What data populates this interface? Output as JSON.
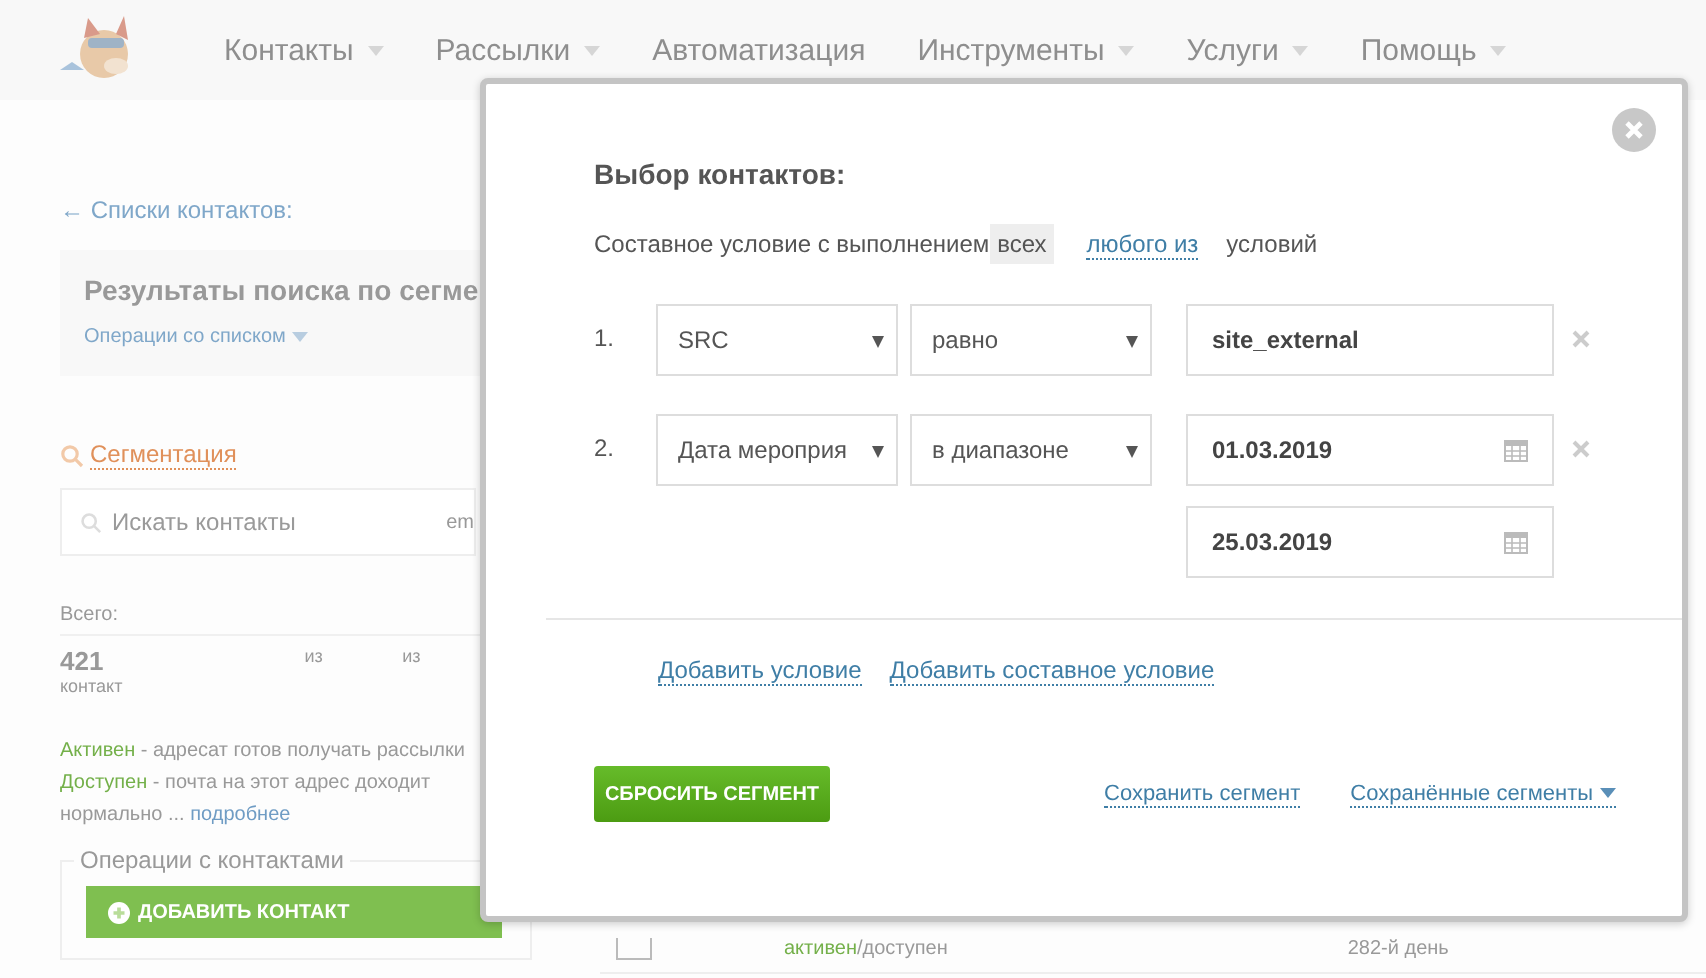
{
  "nav": {
    "items": [
      {
        "label": "Контакты",
        "dropdown": true
      },
      {
        "label": "Рассылки",
        "dropdown": true
      },
      {
        "label": "Автоматизация",
        "dropdown": false
      },
      {
        "label": "Инструменты",
        "dropdown": true
      },
      {
        "label": "Услуги",
        "dropdown": true
      },
      {
        "label": "Помощь",
        "dropdown": true
      }
    ]
  },
  "back_link": "← Списки контактов:",
  "list_panel": {
    "title": "Результаты поиска по сегме",
    "operations": "Операции со списком"
  },
  "segmentation_link": "Сегментация",
  "search": {
    "placeholder": "Искать контакты",
    "column_2": "em"
  },
  "stats": {
    "label": "Всего:",
    "count": "421",
    "unit": "контакт",
    "column_2": "из",
    "column_3": "из"
  },
  "legend": [
    {
      "term": "Активен",
      "text": " - адресат готов получать рассылки"
    },
    {
      "term": "Доступен",
      "text": " - почта на этот адрес доходит нормально ... ",
      "link": "подробнее"
    }
  ],
  "contact_operations": {
    "title": "Операции с контактами",
    "add_button": "ДОБАВИТЬ КОНТАКТ"
  },
  "table_row": {
    "checked": false,
    "status_active": "активен",
    "status_available": "/доступен",
    "column_3": "282-й день"
  },
  "modal": {
    "title": "Выбор контактов:",
    "match": {
      "prefix": "Составное условие с выполнением",
      "options": [
        {
          "label": "всех",
          "selected": true
        },
        {
          "label": "любого из",
          "selected": false
        }
      ],
      "suffix": "условий"
    },
    "conditions": [
      {
        "number": "1.",
        "field": "SRC",
        "operator": "равно",
        "kind": "text",
        "values": [
          "site_external"
        ]
      },
      {
        "number": "2.",
        "field": "Дата мероприя",
        "operator": "в диапазоне",
        "kind": "date_range",
        "values": [
          "01.03.2019",
          "25.03.2019"
        ]
      }
    ],
    "add_links": [
      "Добавить условие",
      "Добавить составное условие"
    ],
    "reset_button": "СБРОСИТЬ СЕГМЕНТ",
    "save_link": "Сохранить сегмент",
    "saved_menu": "Сохранённые сегменты"
  }
}
